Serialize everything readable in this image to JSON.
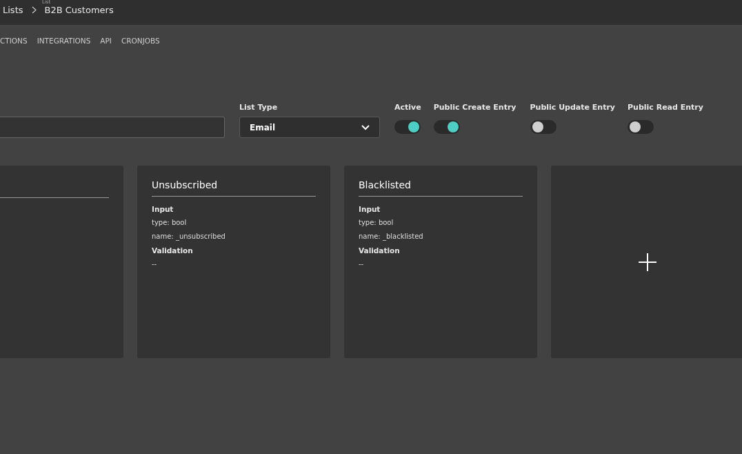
{
  "header": {
    "caption": "List",
    "breadcrumbs": [
      {
        "label": "Lists"
      },
      {
        "label": "B2B Customers"
      }
    ]
  },
  "tabs": [
    {
      "label": "CTIONS"
    },
    {
      "label": "INTEGRATIONS"
    },
    {
      "label": "API"
    },
    {
      "label": "CRONJOBS"
    }
  ],
  "form": {
    "list_type": {
      "label": "List Type",
      "value": "Email"
    },
    "toggles": [
      {
        "label": "Active",
        "on": true
      },
      {
        "label": "Public Create Entry",
        "on": true
      },
      {
        "label": "Public Update Entry",
        "on": false
      },
      {
        "label": "Public Read Entry",
        "on": false
      }
    ]
  },
  "cards": [
    {
      "kind": "cut"
    },
    {
      "kind": "field",
      "title": "Unsubscribed",
      "input_heading": "Input",
      "type": "type: bool",
      "name": "name: _unsubscribed",
      "validation_heading": "Validation",
      "validation": "--"
    },
    {
      "kind": "field",
      "title": "Blacklisted",
      "input_heading": "Input",
      "type": "type: bool",
      "name": "name: _blacklisted",
      "validation_heading": "Validation",
      "validation": "--"
    },
    {
      "kind": "add"
    }
  ]
}
